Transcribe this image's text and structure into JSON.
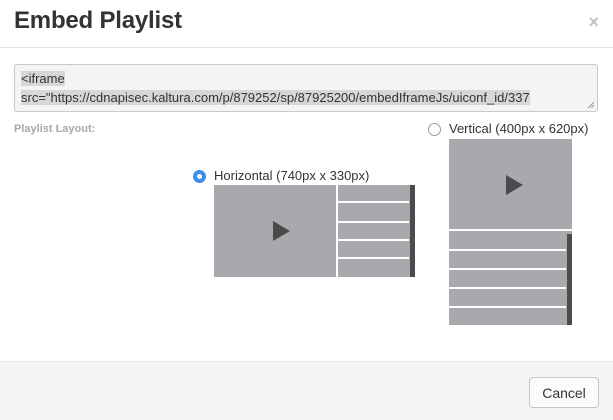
{
  "dialog": {
    "title": "Embed Playlist",
    "close_symbol": "×"
  },
  "embed_code": {
    "line1": "<iframe ",
    "line2": "src=\"https://cdnapisec.kaltura.com/p/879252/sp/87925200/embedIframeJs/uiconf_id/337"
  },
  "layout": {
    "label": "Playlist Layout:",
    "options": [
      {
        "label": "Horizontal (740px x 330px)",
        "selected": true
      },
      {
        "label": "Vertical (400px x 620px)",
        "selected": false
      }
    ]
  },
  "footer": {
    "cancel_label": "Cancel"
  },
  "colors": {
    "radio_selected": "#3b8eea",
    "preview_gray": "#a7a9ad"
  },
  "icons": [
    "close-icon",
    "play-icon",
    "resize-grip-icon"
  ]
}
